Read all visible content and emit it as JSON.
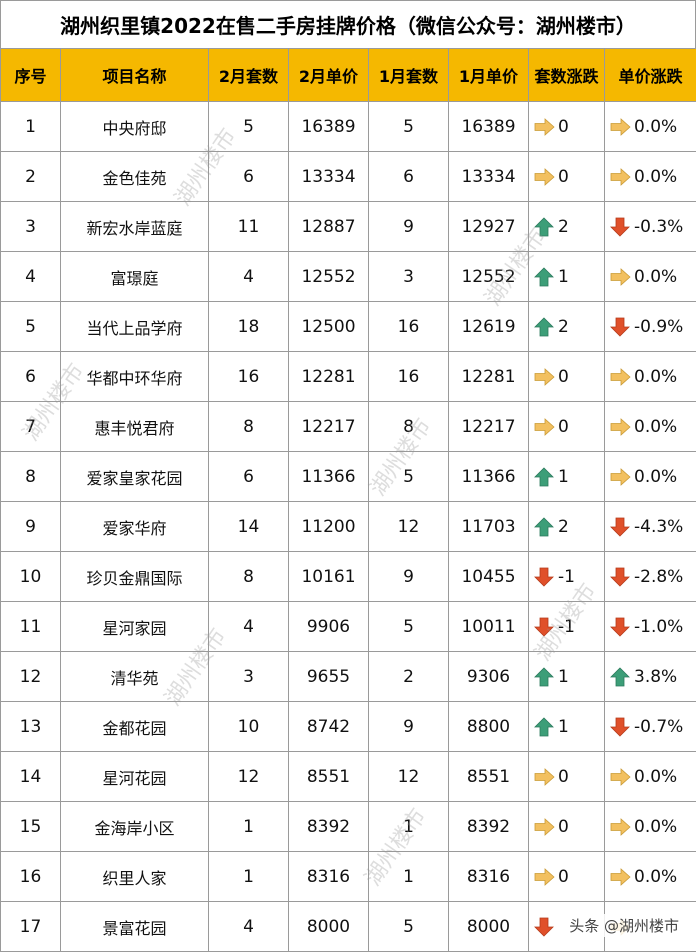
{
  "title": "湖州织里镇2022在售二手房挂牌价格（微信公众号：湖州楼市）",
  "headers": [
    "序号",
    "项目名称",
    "2月套数",
    "2月单价",
    "1月套数",
    "1月单价",
    "套数涨跌",
    "单价涨跌"
  ],
  "rows": [
    {
      "no": "1",
      "name": "中央府邸",
      "feb_sets": "5",
      "feb_price": "16389",
      "jan_sets": "5",
      "jan_price": "16389",
      "sets_dir": "flat",
      "sets_change": "0",
      "price_dir": "flat",
      "price_change": "0.0%"
    },
    {
      "no": "2",
      "name": "金色佳苑",
      "feb_sets": "6",
      "feb_price": "13334",
      "jan_sets": "6",
      "jan_price": "13334",
      "sets_dir": "flat",
      "sets_change": "0",
      "price_dir": "flat",
      "price_change": "0.0%"
    },
    {
      "no": "3",
      "name": "新宏水岸蓝庭",
      "feb_sets": "11",
      "feb_price": "12887",
      "jan_sets": "9",
      "jan_price": "12927",
      "sets_dir": "up",
      "sets_change": "2",
      "price_dir": "down",
      "price_change": "-0.3%"
    },
    {
      "no": "4",
      "name": "富璟庭",
      "feb_sets": "4",
      "feb_price": "12552",
      "jan_sets": "3",
      "jan_price": "12552",
      "sets_dir": "up",
      "sets_change": "1",
      "price_dir": "flat",
      "price_change": "0.0%"
    },
    {
      "no": "5",
      "name": "当代上品学府",
      "feb_sets": "18",
      "feb_price": "12500",
      "jan_sets": "16",
      "jan_price": "12619",
      "sets_dir": "up",
      "sets_change": "2",
      "price_dir": "down",
      "price_change": "-0.9%"
    },
    {
      "no": "6",
      "name": "华都中环华府",
      "feb_sets": "16",
      "feb_price": "12281",
      "jan_sets": "16",
      "jan_price": "12281",
      "sets_dir": "flat",
      "sets_change": "0",
      "price_dir": "flat",
      "price_change": "0.0%"
    },
    {
      "no": "7",
      "name": "惠丰悦君府",
      "feb_sets": "8",
      "feb_price": "12217",
      "jan_sets": "8",
      "jan_price": "12217",
      "sets_dir": "flat",
      "sets_change": "0",
      "price_dir": "flat",
      "price_change": "0.0%"
    },
    {
      "no": "8",
      "name": "爱家皇家花园",
      "feb_sets": "6",
      "feb_price": "11366",
      "jan_sets": "5",
      "jan_price": "11366",
      "sets_dir": "up",
      "sets_change": "1",
      "price_dir": "flat",
      "price_change": "0.0%"
    },
    {
      "no": "9",
      "name": "爱家华府",
      "feb_sets": "14",
      "feb_price": "11200",
      "jan_sets": "12",
      "jan_price": "11703",
      "sets_dir": "up",
      "sets_change": "2",
      "price_dir": "down",
      "price_change": "-4.3%"
    },
    {
      "no": "10",
      "name": "珍贝金鼎国际",
      "feb_sets": "8",
      "feb_price": "10161",
      "jan_sets": "9",
      "jan_price": "10455",
      "sets_dir": "down",
      "sets_change": "-1",
      "price_dir": "down",
      "price_change": "-2.8%"
    },
    {
      "no": "11",
      "name": "星河家园",
      "feb_sets": "4",
      "feb_price": "9906",
      "jan_sets": "5",
      "jan_price": "10011",
      "sets_dir": "down",
      "sets_change": "-1",
      "price_dir": "down",
      "price_change": "-1.0%"
    },
    {
      "no": "12",
      "name": "清华苑",
      "feb_sets": "3",
      "feb_price": "9655",
      "jan_sets": "2",
      "jan_price": "9306",
      "sets_dir": "up",
      "sets_change": "1",
      "price_dir": "up",
      "price_change": "3.8%"
    },
    {
      "no": "13",
      "name": "金都花园",
      "feb_sets": "10",
      "feb_price": "8742",
      "jan_sets": "9",
      "jan_price": "8800",
      "sets_dir": "up",
      "sets_change": "1",
      "price_dir": "down",
      "price_change": "-0.7%"
    },
    {
      "no": "14",
      "name": "星河花园",
      "feb_sets": "12",
      "feb_price": "8551",
      "jan_sets": "12",
      "jan_price": "8551",
      "sets_dir": "flat",
      "sets_change": "0",
      "price_dir": "flat",
      "price_change": "0.0%"
    },
    {
      "no": "15",
      "name": "金海岸小区",
      "feb_sets": "1",
      "feb_price": "8392",
      "jan_sets": "1",
      "jan_price": "8392",
      "sets_dir": "flat",
      "sets_change": "0",
      "price_dir": "flat",
      "price_change": "0.0%"
    },
    {
      "no": "16",
      "name": "织里人家",
      "feb_sets": "1",
      "feb_price": "8316",
      "jan_sets": "1",
      "jan_price": "8316",
      "sets_dir": "flat",
      "sets_change": "0",
      "price_dir": "flat",
      "price_change": "0.0%"
    },
    {
      "no": "17",
      "name": "景富花园",
      "feb_sets": "4",
      "feb_price": "8000",
      "jan_sets": "5",
      "jan_price": "8000",
      "sets_dir": "down",
      "sets_change": "",
      "price_dir": "flat",
      "price_change": ""
    }
  ],
  "watermark_text": "湖州楼市",
  "footer_text": "头条 @湖州楼市",
  "colors": {
    "header_bg": "#f5b800",
    "up_arrow": "#3d9e78",
    "down_arrow": "#e0502a",
    "flat_arrow": "#f2c060"
  }
}
